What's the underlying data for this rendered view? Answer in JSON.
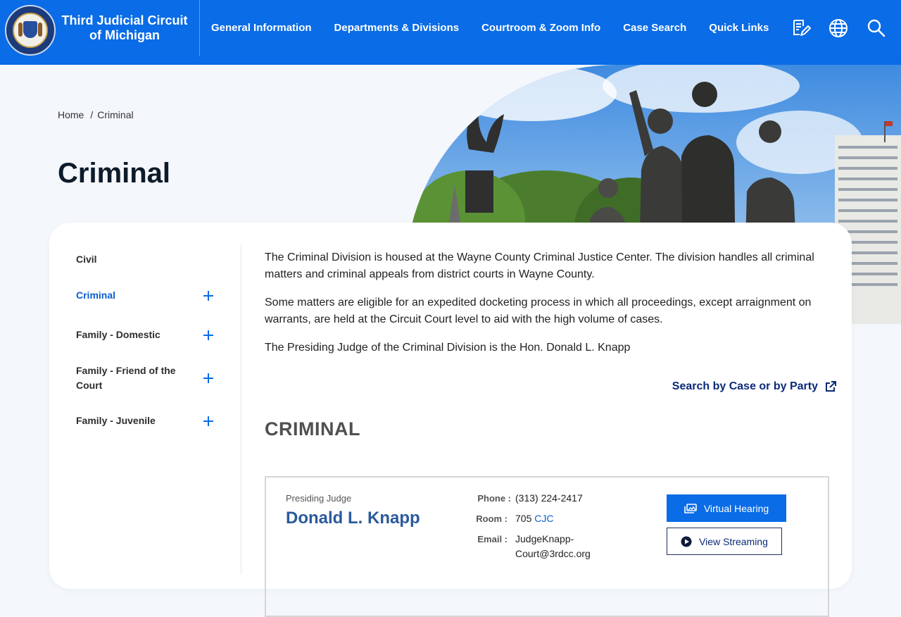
{
  "header": {
    "site_title": "Third Judicial Circuit of Michigan",
    "nav": [
      "General Information",
      "Departments & Divisions",
      "Courtroom & Zoom Info",
      "Case Search",
      "Quick Links"
    ],
    "colors": {
      "header_bg": "#0a6ce6",
      "accent": "#0a5fd0"
    }
  },
  "icons": {
    "forms": "document-edit-icon",
    "language": "globe-icon",
    "search": "search-icon"
  },
  "breadcrumb": {
    "home": "Home",
    "separator": "/",
    "current": "Criminal"
  },
  "page_title": "Criminal",
  "sidenav": {
    "items": [
      {
        "label": "Civil",
        "expandable": false,
        "active": false
      },
      {
        "label": "Criminal",
        "expandable": true,
        "active": true
      },
      {
        "label": "Family - Domestic",
        "expandable": true,
        "active": false
      },
      {
        "label": "Family - Friend of the Court",
        "expandable": true,
        "active": false
      },
      {
        "label": "Family - Juvenile",
        "expandable": true,
        "active": false
      }
    ]
  },
  "content": {
    "paragraphs": [
      "The Criminal Division is housed at the Wayne County Criminal Justice Center. The division handles all criminal matters and criminal appeals from district courts in Wayne County.",
      "Some matters are eligible for an expedited docketing process in which all proceedings, except arraignment on warrants, are held at the Circuit Court level to aid with the high volume of cases.",
      "The Presiding Judge of the Criminal Division is the Hon. Donald L. Knapp"
    ],
    "search_link": "Search by Case or by Party",
    "section_heading": "CRIMINAL"
  },
  "judge": {
    "role": "Presiding Judge",
    "name": "Donald L. Knapp",
    "phone_label": "Phone :",
    "phone": "(313) 224-2417",
    "room_label": "Room :",
    "room_number": "705",
    "room_building": "CJC",
    "email_label": "Email :",
    "email": "JudgeKnapp-Court@3rdcc.org",
    "virtual_hearing": "Virtual Hearing",
    "view_streaming": "View Streaming"
  }
}
